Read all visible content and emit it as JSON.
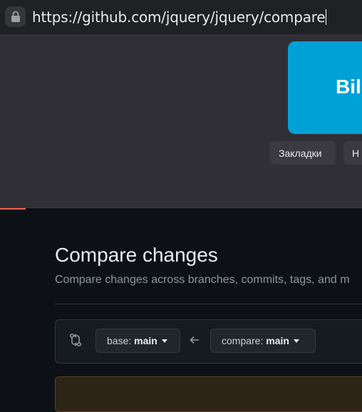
{
  "browser": {
    "url": "https://github.com/jquery/jquery/compare"
  },
  "dropdown": {
    "tile_label": "Bili",
    "chips": [
      "Закладки",
      "Н"
    ]
  },
  "compare": {
    "title": "Compare changes",
    "subtitle": "Compare changes across branches, commits, tags, and m",
    "base_prefix": "base:",
    "base_value": "main",
    "compare_prefix": "compare:",
    "compare_value": "main"
  },
  "colors": {
    "tile": "#00a1d6",
    "page_bg": "#0d1117",
    "panel_bg": "#2f2f35",
    "accent": "#f1614a"
  }
}
